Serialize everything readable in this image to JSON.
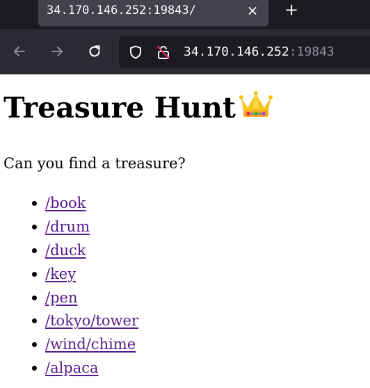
{
  "browser": {
    "tab_title": "34.170.146.252:19843/",
    "url_host": "34.170.146.252",
    "url_port": ":19843"
  },
  "page": {
    "heading": "Treasure Hunt",
    "heading_emoji": "crown",
    "intro": "Can you find a treasure?",
    "links": [
      {
        "label": "/book",
        "visited": true
      },
      {
        "label": "/drum",
        "visited": true
      },
      {
        "label": "/duck",
        "visited": true
      },
      {
        "label": "/key",
        "visited": true
      },
      {
        "label": "/pen",
        "visited": true
      },
      {
        "label": "/tokyo/tower",
        "visited": true
      },
      {
        "label": "/wind/chime",
        "visited": true
      },
      {
        "label": "/alpaca",
        "visited": true
      }
    ]
  },
  "colors": {
    "visited_link": "#551a8b",
    "chrome_dark": "#1c1b22",
    "toolbar": "#2b2a33",
    "active_tab": "#42414d"
  }
}
